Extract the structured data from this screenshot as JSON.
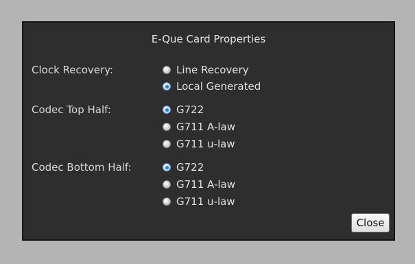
{
  "dialog": {
    "title": "E-Que Card Properties",
    "groups": [
      {
        "label": "Clock Recovery:",
        "options": [
          {
            "label": "Line Recovery",
            "selected": false
          },
          {
            "label": "Local Generated",
            "selected": true
          }
        ]
      },
      {
        "label": "Codec Top Half:",
        "options": [
          {
            "label": "G722",
            "selected": true
          },
          {
            "label": "G711 A-law",
            "selected": false
          },
          {
            "label": "G711 u-law",
            "selected": false
          }
        ]
      },
      {
        "label": "Codec Bottom Half:",
        "options": [
          {
            "label": "G722",
            "selected": true
          },
          {
            "label": "G711 A-law",
            "selected": false
          },
          {
            "label": "G711 u-law",
            "selected": false
          }
        ]
      }
    ],
    "close_label": "Close"
  }
}
